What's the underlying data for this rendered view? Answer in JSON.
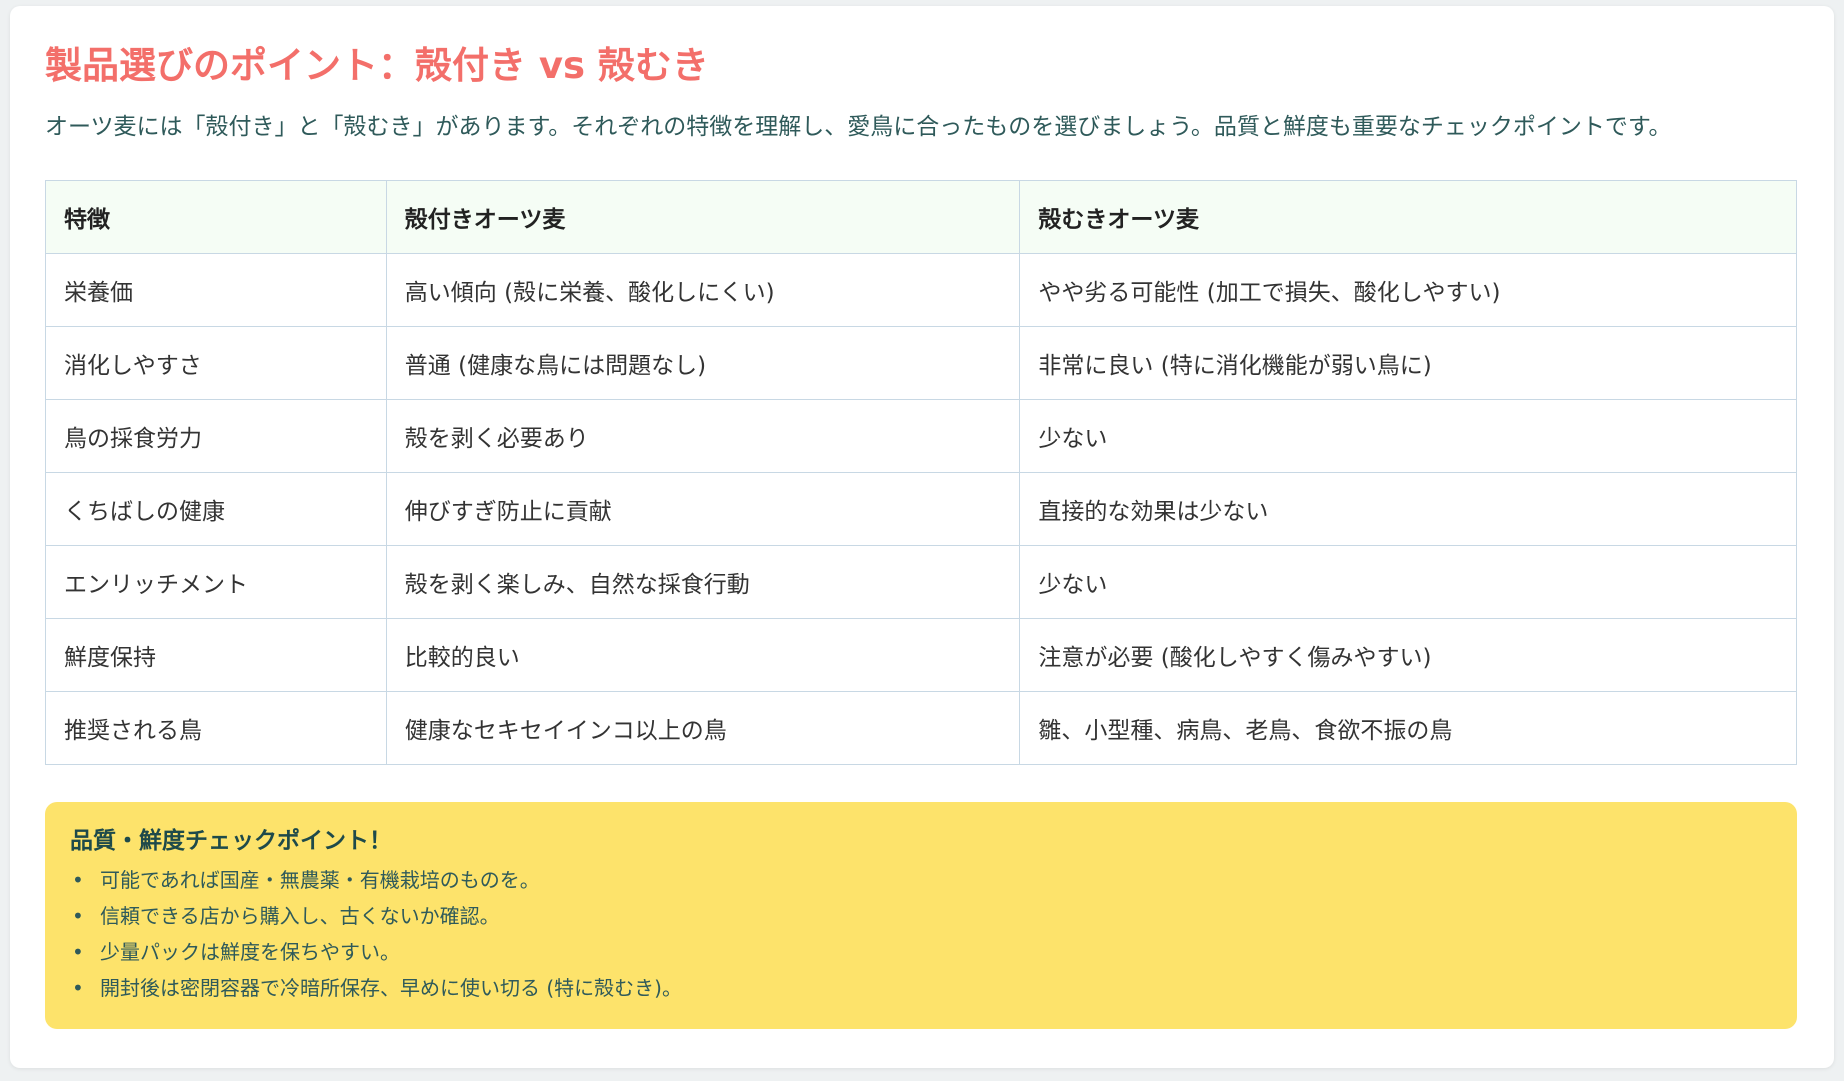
{
  "title": "製品選びのポイント：殻付き vs 殻むき",
  "intro": "オーツ麦には「殻付き」と「殻むき」があります。それぞれの特徴を理解し、愛鳥に合ったものを選びましょう。品質と鮮度も重要なチェックポイントです。",
  "table": {
    "headers": [
      "特徴",
      "殻付きオーツ麦",
      "殻むきオーツ麦"
    ],
    "rows": [
      [
        "栄養価",
        "高い傾向 (殻に栄養、酸化しにくい)",
        "やや劣る可能性 (加工で損失、酸化しやすい)"
      ],
      [
        "消化しやすさ",
        "普通 (健康な鳥には問題なし)",
        "非常に良い (特に消化機能が弱い鳥に)"
      ],
      [
        "鳥の採食労力",
        "殻を剥く必要あり",
        "少ない"
      ],
      [
        "くちばしの健康",
        "伸びすぎ防止に貢献",
        "直接的な効果は少ない"
      ],
      [
        "エンリッチメント",
        "殻を剥く楽しみ、自然な採食行動",
        "少ない"
      ],
      [
        "鮮度保持",
        "比較的良い",
        "注意が必要 (酸化しやすく傷みやすい)"
      ],
      [
        "推奨される鳥",
        "健康なセキセイインコ以上の鳥",
        "雛、小型種、病鳥、老鳥、食欲不振の鳥"
      ]
    ]
  },
  "tips": {
    "title": "品質・鮮度チェックポイント！",
    "bullet": "•",
    "items": [
      "可能であれば国産・無農薬・有機栽培のものを。",
      "信頼できる店から購入し、古くないか確認。",
      "少量パックは鮮度を保ちやすい。",
      "開封後は密閉容器で冷暗所保存、早めに使い切る (特に殻むき)。"
    ]
  },
  "colors": {
    "title": "#f36f6a",
    "text": "#2f5a5a",
    "header_bg": "#f5fdf5",
    "border": "#c8d8e4",
    "tips_bg": "#fde36b"
  }
}
